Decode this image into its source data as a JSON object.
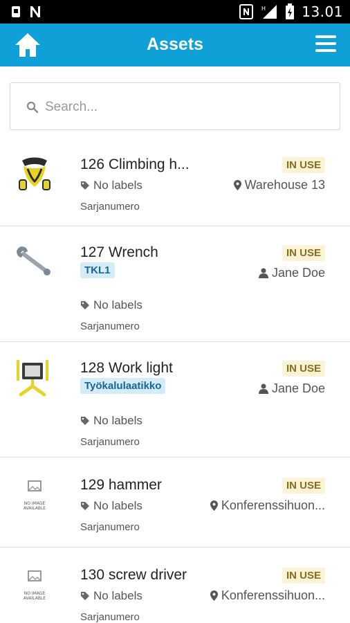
{
  "status_bar": {
    "time": "13.01"
  },
  "header": {
    "title": "Assets"
  },
  "search": {
    "placeholder": "Search..."
  },
  "no_image_text": "NO IMAGE AVAILABLE",
  "items": [
    {
      "name": "126 Climbing h...",
      "status": "IN USE",
      "labels": "No labels",
      "serial": "Sarjanumero",
      "location": "Warehouse 13",
      "location_type": "place",
      "image": "harness"
    },
    {
      "name": "127 Wrench",
      "status": "IN USE",
      "tag": "TKL1",
      "labels": "No labels",
      "serial": "Sarjanumero",
      "location": "Jane Doe",
      "location_type": "person",
      "image": "wrench"
    },
    {
      "name": "128 Work light",
      "status": "IN USE",
      "tag": "Työkalulaatikko",
      "labels": "No labels",
      "serial": "Sarjanumero",
      "location": "Jane Doe",
      "location_type": "person",
      "image": "worklight"
    },
    {
      "name": "129 hammer",
      "status": "IN USE",
      "labels": "No labels",
      "serial": "Sarjanumero",
      "location": "Konferenssihuon...",
      "location_type": "place",
      "image": "none"
    },
    {
      "name": "130 screw driver",
      "status": "IN USE",
      "labels": "No labels",
      "serial": "Sarjanumero",
      "location": "Konferenssihuon...",
      "location_type": "place",
      "image": "none"
    }
  ],
  "colors": {
    "accent": "#0fa0d8",
    "badge_bg": "#fbf3d5",
    "badge_text": "#8a6d1c",
    "tag_bg": "#d4ecf7",
    "tag_text": "#17639a"
  }
}
